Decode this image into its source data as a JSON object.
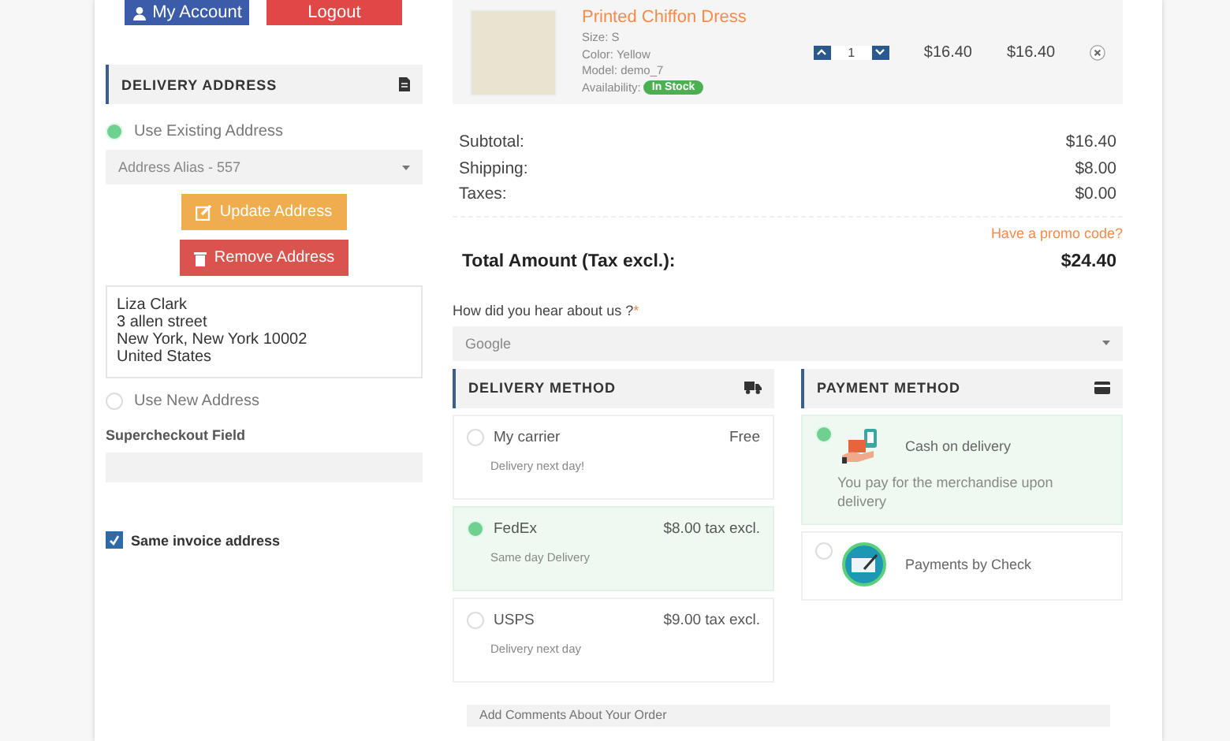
{
  "top_buttons": [
    {
      "label": "My Account",
      "kind": "account"
    },
    {
      "label": "Logout",
      "kind": "logout"
    }
  ],
  "delivery_address": {
    "title": "DELIVERY ADDRESS",
    "address_options": [
      {
        "label": "Use Existing Address",
        "selected": true
      },
      {
        "label": "Use New Address",
        "selected": false
      }
    ],
    "address_select": "Address Alias - 557",
    "buttons": [
      {
        "label": "Update Address",
        "kind": "update"
      },
      {
        "label": "Remove Address",
        "kind": "remove"
      }
    ],
    "address_lines": [
      "Liza Clark",
      "3 allen street",
      "New York, New York 10002",
      "United States"
    ],
    "custom_field": {
      "label": "Supercheckout Field"
    },
    "same_invoice": {
      "label": "Same invoice address",
      "checked": true
    }
  },
  "cart": {
    "product": {
      "name": "Printed Chiffon Dress",
      "details": [
        "Size: S",
        "Color: Yellow",
        "Model: demo_7"
      ],
      "availability_label": "Availability:",
      "availability": "In Stock",
      "quantity": "1",
      "unit_price": "$16.40",
      "total_price": "$16.40"
    },
    "totals": [
      {
        "label": "Subtotal:",
        "value": "$16.40"
      },
      {
        "label": "Shipping:",
        "value": "$8.00"
      },
      {
        "label": "Taxes:",
        "value": "$0.00"
      }
    ],
    "promo_link": "Have a promo code?",
    "total": {
      "label": "Total Amount (Tax excl.):",
      "value": "$24.40"
    }
  },
  "survey": {
    "question": "How did you hear about us ?",
    "required": "*",
    "value": "Google"
  },
  "delivery_method": {
    "title": "DELIVERY METHOD",
    "options": [
      {
        "name": "My carrier",
        "price": "Free",
        "note": "Delivery next day!",
        "selected": false
      },
      {
        "name": "FedEx",
        "price": "$8.00 tax excl.",
        "note": "Same day Delivery",
        "selected": true
      },
      {
        "name": "USPS",
        "price": "$9.00 tax excl.",
        "note": "Delivery next day",
        "selected": false
      }
    ]
  },
  "payment_method": {
    "title": "PAYMENT METHOD",
    "options": [
      {
        "name": "Cash on delivery",
        "kind": "cash",
        "description": "You pay for the merchandise upon delivery",
        "selected": true
      },
      {
        "name": "Payments by Check",
        "kind": "check",
        "selected": false
      }
    ]
  },
  "comments": {
    "placeholder": "Add Comments About Your Order"
  }
}
